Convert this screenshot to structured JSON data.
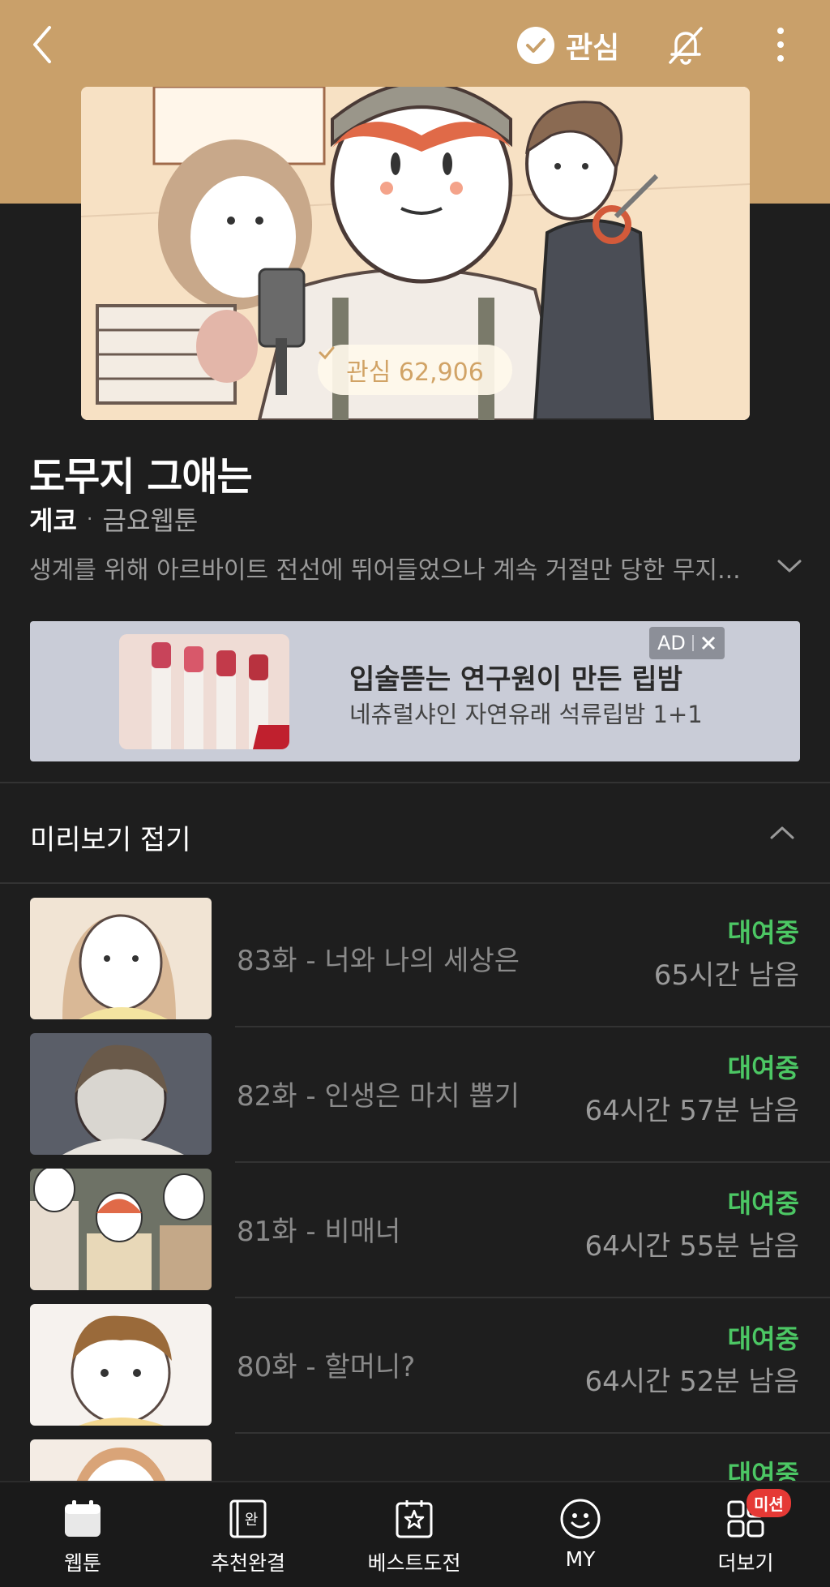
{
  "header": {
    "favorite_label": "관심"
  },
  "cover": {
    "favorite_badge_label": "관심 62,906"
  },
  "webtoon": {
    "title": "도무지 그애는",
    "author": "게코",
    "day": "금요웹툰",
    "synopsis": "생계를 위해 아르바이트 전선에 뛰어들었으나 계속 거절만 당한 무지..."
  },
  "ad": {
    "headline": "입술뜯는 연구원이 만든 립밤",
    "subtext": "네츄럴샤인 자연유래 석류립밤 1+1",
    "tag": "AD"
  },
  "preview_section": {
    "label": "미리보기 접기"
  },
  "episodes": [
    {
      "title": "83화 - 너와 나의 세상은",
      "status": "대여중",
      "remaining": "65시간 남음"
    },
    {
      "title": "82화 - 인생은 마치 뽑기",
      "status": "대여중",
      "remaining": "64시간 57분 남음"
    },
    {
      "title": "81화 - 비매너",
      "status": "대여중",
      "remaining": "64시간 55분 남음"
    },
    {
      "title": "80화 - 할머니?",
      "status": "대여중",
      "remaining": "64시간 52분 남음"
    },
    {
      "title": "",
      "status": "대여중",
      "remaining": ""
    }
  ],
  "bottom_nav": [
    {
      "label": "웹툰",
      "icon": "calendar-icon"
    },
    {
      "label": "추천완결",
      "icon": "book-complete-icon"
    },
    {
      "label": "베스트도전",
      "icon": "star-book-icon"
    },
    {
      "label": "MY",
      "icon": "smiley-icon"
    },
    {
      "label": "더보기",
      "icon": "grid-icon",
      "badge": "미션"
    }
  ],
  "colors": {
    "header_band": "#c9a06a",
    "background": "#1e1e1e",
    "rental_green": "#4cc764",
    "ad_background": "#c9ccd7"
  }
}
